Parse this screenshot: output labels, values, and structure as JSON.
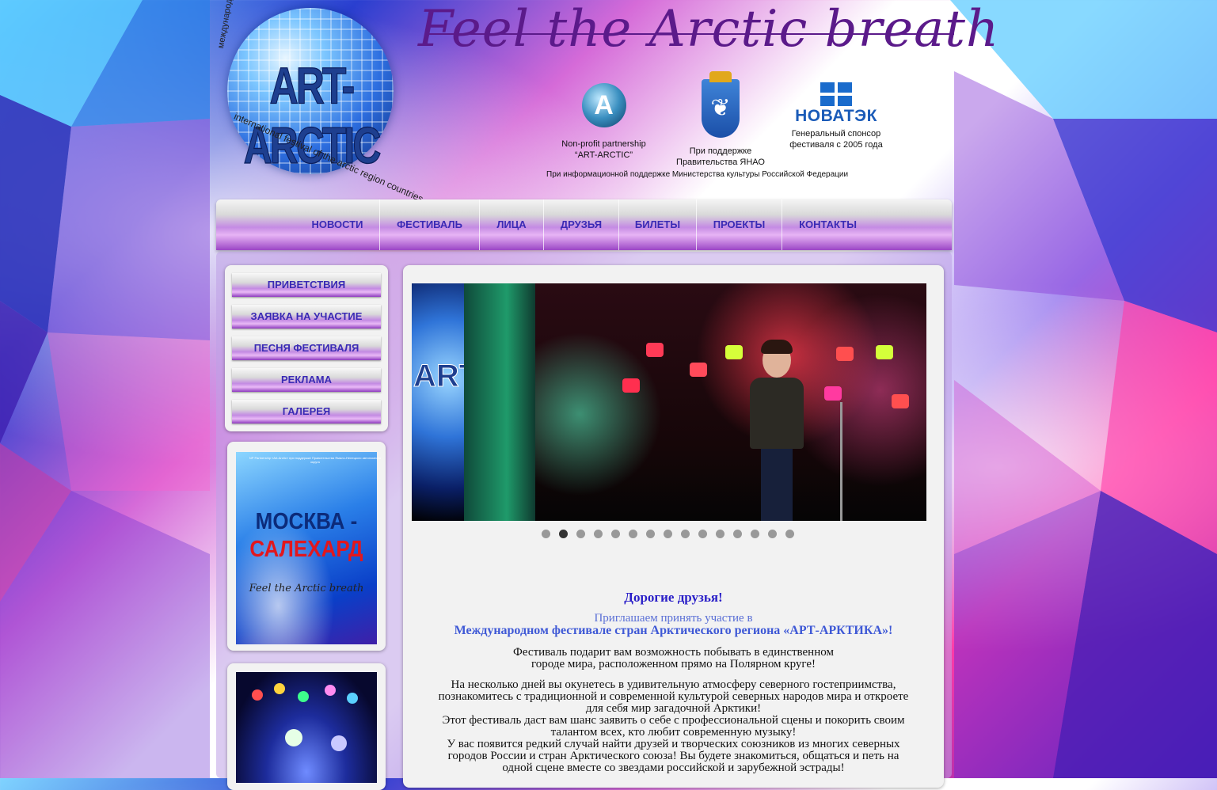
{
  "colors": {
    "accent": "#3a2ab5",
    "brand": "#5b1a8a",
    "heading": "#2a1fc8",
    "subheading": "#3f59d6"
  },
  "header": {
    "logo_text": "ART-ARCTIC",
    "logo_ring_ru": "международный фестиваль стран арктического региона",
    "logo_ring_en": "international festival of the arctic region countries",
    "tagline": "Feel the Arctic breath",
    "sponsors": [
      {
        "icon": "art-arctic-logo-icon",
        "line1": "Non-profit partnership",
        "line2": "“ART-ARCTIC”"
      },
      {
        "icon": "yamal-crest-icon",
        "line1": "При поддержке",
        "line2": "Правительства ЯНАО"
      },
      {
        "icon": "novatek-logo-icon",
        "brand": "НОВАТЭК",
        "line1": "Генеральный спонсор",
        "line2": "фестиваля с 2005 года"
      }
    ],
    "info_support": "При информационной поддержке Министерства культуры Российской Федерации"
  },
  "nav": {
    "items": [
      "НОВОСТИ",
      "ФЕСТИВАЛЬ",
      "ЛИЦА",
      "ДРУЗЬЯ",
      "БИЛЕТЫ",
      "ПРОЕКТЫ",
      "КОНТАКТЫ"
    ]
  },
  "sidebar": {
    "menu": [
      "ПРИВЕТСТВИЯ",
      "ЗАЯВКА НА УЧАСТИЕ",
      "ПЕСНЯ ФЕСТИВАЛЯ",
      "РЕКЛАМА",
      "ГАЛЕРЕЯ"
    ],
    "poster": {
      "small_text": "NP Partnership «Art-Arctic» при поддержке Правительства Ямало-Ненецкого автономного округа",
      "title1": "МОСКВА -",
      "title2": "САЛЕХАРД",
      "tagline": "Feel the Arctic breath"
    }
  },
  "slider": {
    "left_text": "ART",
    "total_slides": 15,
    "active_index": 1
  },
  "content": {
    "greeting": "Дорогие друзья!",
    "invite_line1": "Приглашаем принять участие в",
    "invite_line2": "Международном фестивале стран Арктического региона «АРТ-АРКТИКА»!",
    "paragraphs": [
      [
        "Фестиваль подарит вам возможность побывать в единственном",
        "городе мира, расположенном прямо на Полярном круге!"
      ],
      [
        "На несколько дней вы окунетесь в удивительную атмосферу северного гостеприимства,",
        "познакомитесь с традиционной и современной культурой северных народов мира и откроете",
        "для себя мир загадочной Арктики!",
        "Этот фестиваль даст вам шанс заявить о себе с профессиональной сцены и покорить своим",
        "талантом всех, кто любит современную музыку!",
        "У вас появится  редкий случай найти друзей и творческих союзников из многих северных",
        "городов России и стран Арктического союза! Вы будете знакомиться, общаться и петь на",
        "одной сцене вместе со звездами российской и зарубежной эстрады!"
      ]
    ]
  }
}
